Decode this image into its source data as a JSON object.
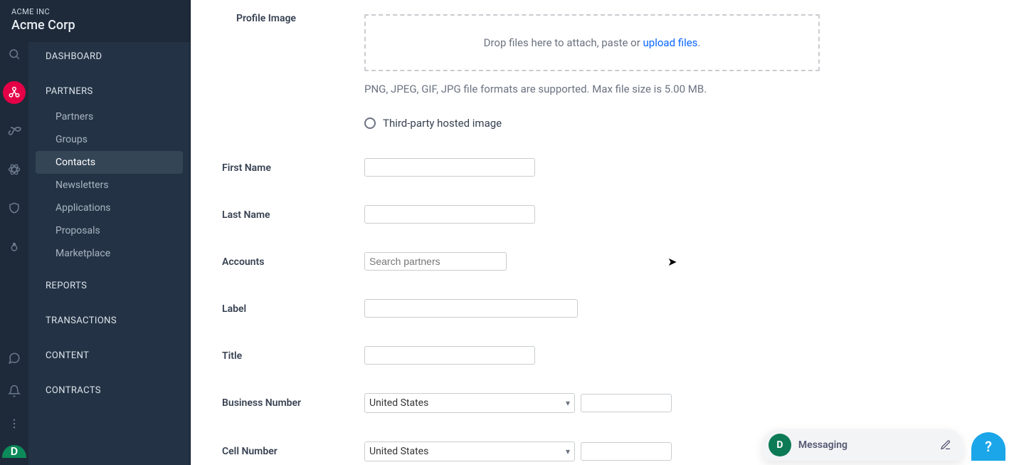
{
  "brand": {
    "small": "ACME INC",
    "big": "Acme Corp"
  },
  "nav": {
    "dashboard": "DASHBOARD",
    "partners_section": "PARTNERS",
    "partners_items": [
      {
        "label": "Partners"
      },
      {
        "label": "Groups"
      },
      {
        "label": "Contacts"
      },
      {
        "label": "Newsletters"
      },
      {
        "label": "Applications"
      },
      {
        "label": "Proposals"
      },
      {
        "label": "Marketplace"
      }
    ],
    "reports": "REPORTS",
    "transactions": "TRANSACTIONS",
    "content": "CONTENT",
    "contracts": "CONTRACTS"
  },
  "form": {
    "profile_image_label": "Profile Image",
    "drop_text_prefix": "Drop files here to attach, paste or ",
    "drop_link": "upload files",
    "drop_suffix": ".",
    "drop_helper": "PNG, JPEG, GIF, JPG file formats are supported. Max file size is 5.00 MB.",
    "radio_third_party": "Third-party hosted image",
    "first_name": "First Name",
    "last_name": "Last Name",
    "accounts": "Accounts",
    "accounts_placeholder": "Search partners",
    "label": "Label",
    "title": "Title",
    "business_number": "Business Number",
    "cell_number": "Cell Number",
    "country_selected": "United States"
  },
  "chat": {
    "avatar_initial": "D",
    "label": "Messaging"
  },
  "help_fab": "?",
  "bottom_avatar_initial": "D"
}
